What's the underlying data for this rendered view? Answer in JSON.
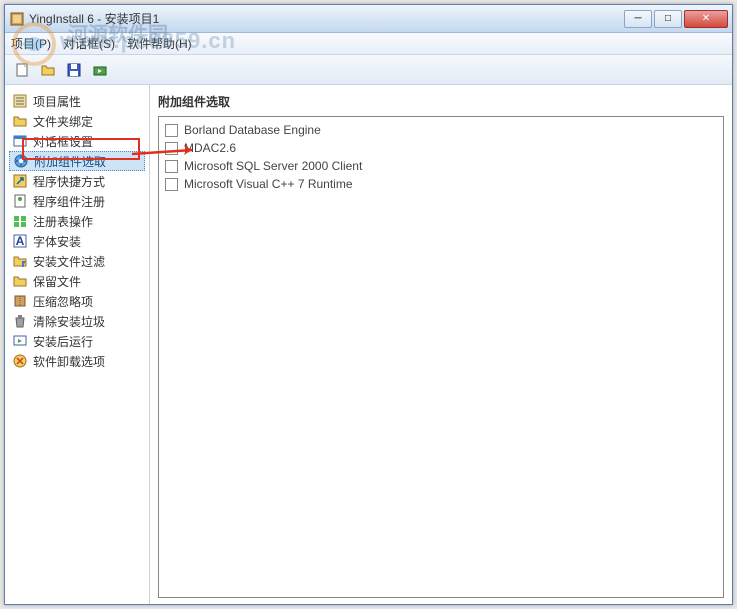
{
  "window": {
    "title": "YingInstall 6 - 安装项目1"
  },
  "menu": {
    "project": "项目(P)",
    "dialog": "对话框(S)",
    "help": "软件帮助(H)"
  },
  "sidebar": {
    "items": [
      {
        "label": "项目属性",
        "icon": "properties"
      },
      {
        "label": "文件夹绑定",
        "icon": "folder"
      },
      {
        "label": "对话框设置",
        "icon": "dialog"
      },
      {
        "label": "附加组件选取",
        "icon": "component",
        "selected": true
      },
      {
        "label": "程序快捷方式",
        "icon": "shortcut"
      },
      {
        "label": "程序组件注册",
        "icon": "register"
      },
      {
        "label": "注册表操作",
        "icon": "registry"
      },
      {
        "label": "字体安装",
        "icon": "font"
      },
      {
        "label": "安装文件过滤",
        "icon": "filter"
      },
      {
        "label": "保留文件",
        "icon": "keep"
      },
      {
        "label": "压缩忽略项",
        "icon": "compress"
      },
      {
        "label": "清除安装垃圾",
        "icon": "clean"
      },
      {
        "label": "安装后运行",
        "icon": "run"
      },
      {
        "label": "软件卸载选项",
        "icon": "uninstall"
      }
    ]
  },
  "main": {
    "title": "附加组件选取",
    "components": [
      "Borland Database Engine",
      "MDAC2.6",
      "Microsoft SQL Server 2000 Client",
      "Microsoft Visual C++ 7 Runtime"
    ]
  },
  "watermark": {
    "url": "www.pc0359.cn",
    "cn": "河源软件园"
  }
}
